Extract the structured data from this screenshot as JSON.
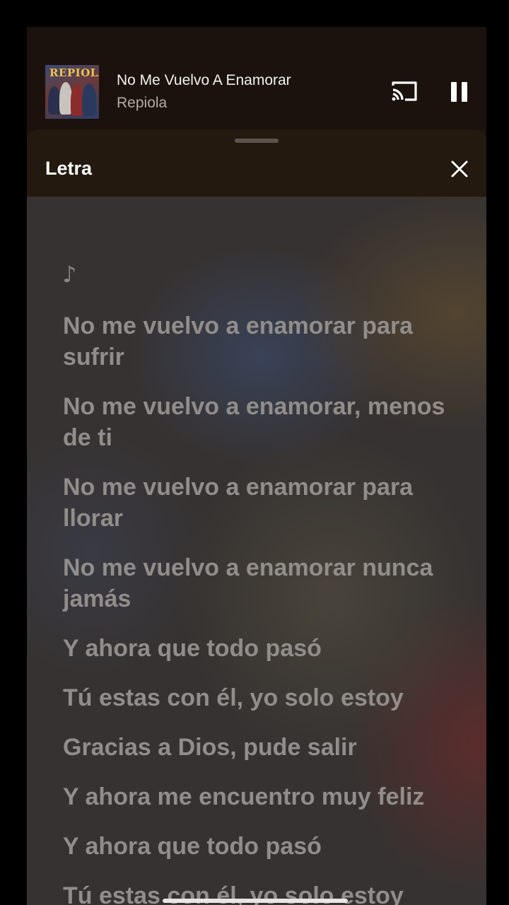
{
  "mini_player": {
    "album_art_text": "REPIOLA",
    "track_title": "No Me Vuelvo A Enamorar",
    "artist": "Repiola",
    "cast_icon": "cast-icon",
    "pause_icon": "pause-icon"
  },
  "lyrics_sheet": {
    "title": "Letra",
    "close_icon": "close-icon",
    "note_symbol": "♪",
    "lines": [
      "No me vuelvo a enamorar para sufrir",
      "No me vuelvo a enamorar, menos de ti",
      "No me vuelvo a enamorar para llorar",
      "No me vuelvo a enamorar nunca jamás",
      "Y ahora que todo pasó",
      "Tú estas con él, yo solo estoy",
      "Gracias a Dios, pude salir",
      "Y ahora me encuentro muy feliz",
      "Y ahora que todo pasó",
      "Tú estas con él, yo solo estoy"
    ]
  }
}
